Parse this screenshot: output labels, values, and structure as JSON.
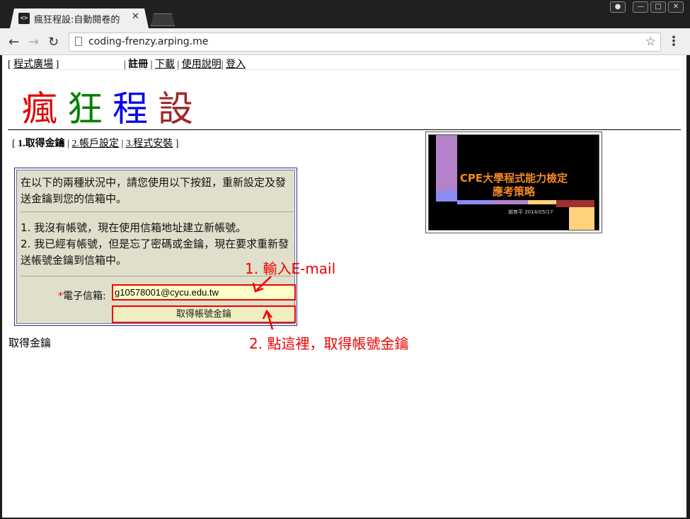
{
  "browser": {
    "tab_title": "瘋狂程設:自動閱卷的",
    "tab_favicon": "<>",
    "url": "coding-frenzy.arping.me",
    "icons": [
      "back-icon",
      "forward-icon",
      "reload-icon",
      "star-icon",
      "menu-icon",
      "close-icon"
    ]
  },
  "topnav": {
    "square": "程式廣場",
    "register": "註冊",
    "download": "下載",
    "manual": "使用說明",
    "login": "登入"
  },
  "logo": {
    "chars": [
      "瘋",
      "狂",
      "程",
      "設"
    ],
    "colors": [
      "#e00000",
      "#008000",
      "#0000ee",
      "#a02828"
    ]
  },
  "subnav": {
    "step1": "1.取得金鑰",
    "step2": "2.帳戶設定",
    "step3": "3.程式安裝"
  },
  "thumbnail": {
    "line1": "CPE大學程式能力檢定",
    "line2": "應考策略",
    "byline": "謝育平 2014/05/17"
  },
  "panel": {
    "intro": "在以下的兩種狀況中，請您使用以下按鈕，重新設定及發送金鑰到您的信箱中。",
    "case1": "1. 我沒有帳號，現在使用信箱地址建立新帳號。",
    "case2": "2. 我已經有帳號，但是忘了密碼或金鑰，現在要求重新發送帳號金鑰到信箱中。",
    "required_mark": "*",
    "email_label": "電子信箱:",
    "email_value": "g10578001@cycu.edu.tw",
    "submit_label": "取得帳號金鑰"
  },
  "footer_text": "取得金鑰",
  "annotations": {
    "step1": "1. 輸入E-mail",
    "step2": "2. 點這裡，取得帳號金鑰",
    "color": "#e00000"
  }
}
